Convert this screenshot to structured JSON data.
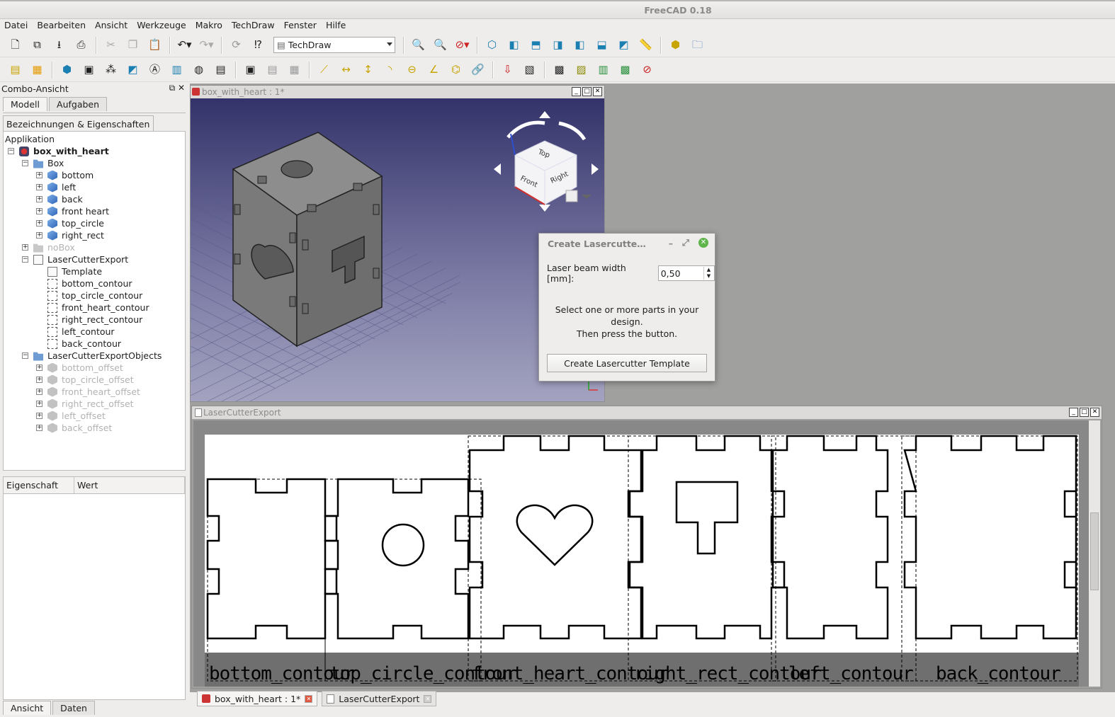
{
  "window": {
    "title": "FreeCAD 0.18"
  },
  "menu": [
    "Datei",
    "Bearbeiten",
    "Ansicht",
    "Werkzeuge",
    "Makro",
    "TechDraw",
    "Fenster",
    "Hilfe"
  ],
  "toolbar": {
    "workbench": "TechDraw"
  },
  "combo": {
    "title": "Combo-Ansicht",
    "tabs": [
      "Modell",
      "Aufgaben"
    ],
    "tree_header": "Bezeichnungen & Eigenschaften",
    "tree_root": "Applikation",
    "tree": [
      {
        "label": "box_with_heart",
        "bold": true,
        "depth": 0,
        "icon": "app",
        "exp": "-"
      },
      {
        "label": "Box",
        "depth": 1,
        "icon": "folder",
        "exp": "-"
      },
      {
        "label": "bottom",
        "depth": 2,
        "icon": "part",
        "exp": "+"
      },
      {
        "label": "left",
        "depth": 2,
        "icon": "part",
        "exp": "+"
      },
      {
        "label": "back",
        "depth": 2,
        "icon": "part",
        "exp": "+"
      },
      {
        "label": "front heart",
        "depth": 2,
        "icon": "part",
        "exp": "+"
      },
      {
        "label": "top_circle",
        "depth": 2,
        "icon": "part",
        "exp": "+"
      },
      {
        "label": "right_rect",
        "depth": 2,
        "icon": "part",
        "exp": "+"
      },
      {
        "label": "noBox",
        "depth": 1,
        "icon": "folder-dim",
        "exp": "+",
        "dim": true
      },
      {
        "label": "LaserCutterExport",
        "depth": 1,
        "icon": "doc",
        "exp": "-"
      },
      {
        "label": "Template",
        "depth": 2,
        "icon": "doc",
        "exp": ""
      },
      {
        "label": "bottom_contour",
        "depth": 2,
        "icon": "view",
        "exp": ""
      },
      {
        "label": "top_circle_contour",
        "depth": 2,
        "icon": "view",
        "exp": ""
      },
      {
        "label": "front_heart_contour",
        "depth": 2,
        "icon": "view",
        "exp": ""
      },
      {
        "label": "right_rect_contour",
        "depth": 2,
        "icon": "view",
        "exp": ""
      },
      {
        "label": "left_contour",
        "depth": 2,
        "icon": "view",
        "exp": ""
      },
      {
        "label": "back_contour",
        "depth": 2,
        "icon": "view",
        "exp": ""
      },
      {
        "label": "LaserCutterExportObjects",
        "depth": 1,
        "icon": "folder",
        "exp": "-"
      },
      {
        "label": "bottom_offset",
        "depth": 2,
        "icon": "dim",
        "exp": "+",
        "dim": true
      },
      {
        "label": "top_circle_offset",
        "depth": 2,
        "icon": "dim",
        "exp": "+",
        "dim": true
      },
      {
        "label": "front_heart_offset",
        "depth": 2,
        "icon": "dim",
        "exp": "+",
        "dim": true
      },
      {
        "label": "right_rect_offset",
        "depth": 2,
        "icon": "dim",
        "exp": "+",
        "dim": true
      },
      {
        "label": "left_offset",
        "depth": 2,
        "icon": "dim",
        "exp": "+",
        "dim": true
      },
      {
        "label": "back_offset",
        "depth": 2,
        "icon": "dim",
        "exp": "+",
        "dim": true
      }
    ],
    "props": {
      "col1": "Eigenschaft",
      "col2": "Wert"
    },
    "bottom_tabs": [
      "Ansicht",
      "Daten"
    ]
  },
  "view3d": {
    "title": "box_with_heart : 1*",
    "cube_faces": [
      "Top",
      "Front",
      "Right"
    ]
  },
  "drawing": {
    "title": "LaserCutterExport",
    "labels": [
      "bottom_contour",
      "top_circle_contour",
      "front_heart_contour",
      "right_rect_contour",
      "left_contour",
      "back_contour"
    ]
  },
  "dialog": {
    "title": "Create Lasercutte…",
    "field_label": "Laser beam width [mm]:",
    "field_value": "0,50",
    "message1": "Select one or more parts in your design.",
    "message2": "Then press the button.",
    "button": "Create Lasercutter Template"
  },
  "doc_tabs": [
    {
      "label": "box_with_heart : 1*",
      "active": true
    },
    {
      "label": "LaserCutterExport",
      "active": false
    }
  ]
}
